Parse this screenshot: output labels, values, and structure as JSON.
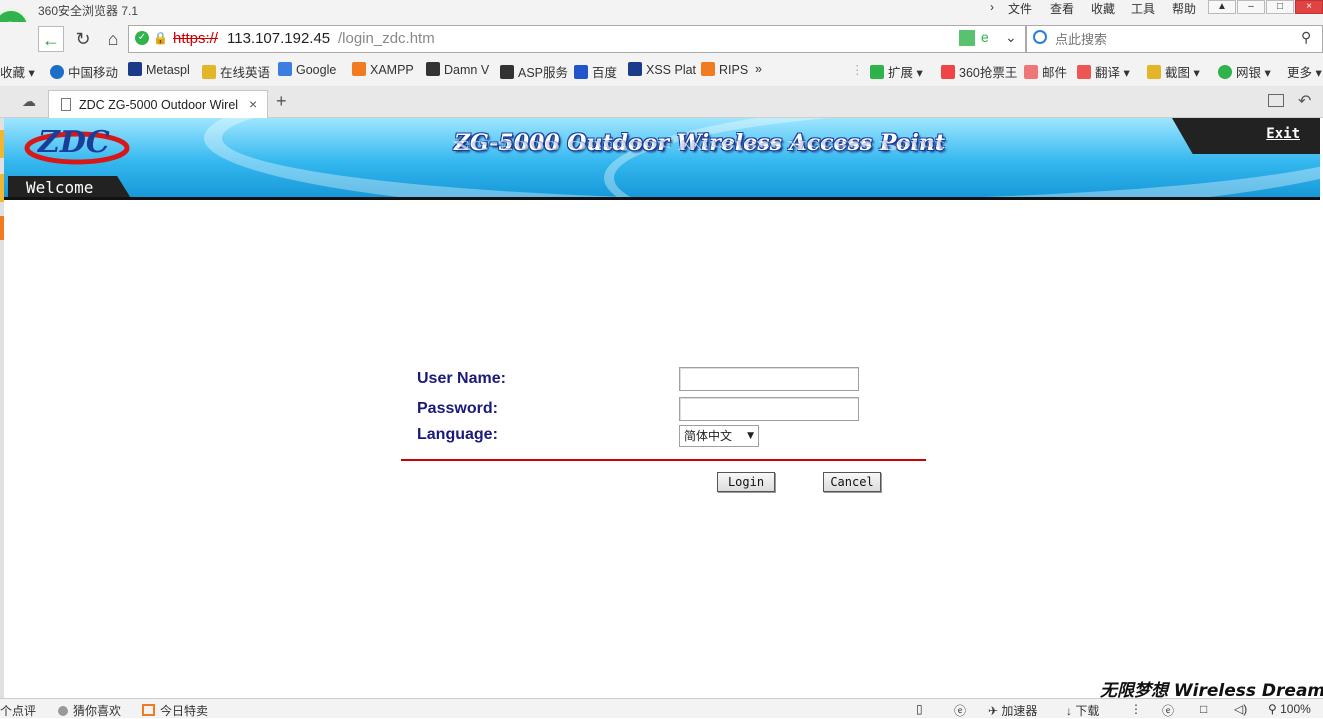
{
  "browser": {
    "app_title": "360安全浏览器 7.1",
    "menu": [
      "文件",
      "查看",
      "收藏",
      "工具",
      "帮助"
    ],
    "url": {
      "scheme": "https://",
      "host": "113.107.192.45",
      "path": "/login_zdc.htm"
    },
    "search_placeholder": "点此搜索",
    "bookmarks_left": [
      "收藏",
      "中国移动",
      "Metaspl",
      "在线英语",
      "Google",
      "XAMPP",
      "Damn V",
      "ASP服务",
      "百度",
      "XSS Plat",
      "RIPS"
    ],
    "more_chevron": "»",
    "bookmarks_right": [
      "扩展",
      "360抢票王",
      "邮件",
      "翻译",
      "截图",
      "网银",
      "更多"
    ],
    "tab_title": "ZDC ZG-5000 Outdoor Wirel",
    "tab_close": "×",
    "new_tab": "+"
  },
  "banner": {
    "logo_text": "ZDC",
    "welcome": "Welcome",
    "title": "ZG-5000 Outdoor Wireless Access Point",
    "exit": "Exit"
  },
  "form": {
    "username_label": "User Name:",
    "password_label": "Password:",
    "language_label": "Language:",
    "username_value": "",
    "password_value": "",
    "language_value": "简体中文",
    "login_button": "Login",
    "cancel_button": "Cancel"
  },
  "statusbar": {
    "items_left": [
      "个点评",
      "猜你喜欢",
      "今日特卖"
    ],
    "items_right": [
      "加速器",
      "下载"
    ],
    "zoom": "100%",
    "watermark": "无限梦想 Wireless Dream"
  },
  "colors": {
    "label": "#1a1a7a",
    "divider": "#cc0000",
    "banner_blue": "#35b8ef",
    "green_accent": "#2fb34a"
  }
}
